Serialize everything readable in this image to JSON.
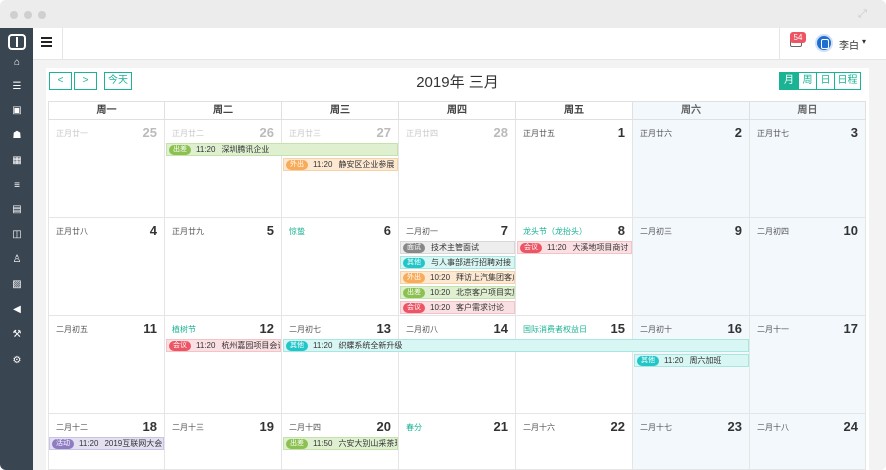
{
  "window": {
    "controls": [
      "close",
      "minimize",
      "zoom"
    ]
  },
  "sidebar": {
    "icons": [
      "logo-icon",
      "home-icon",
      "list-icon",
      "briefcase-icon",
      "users-icon",
      "calendar-icon",
      "table-icon",
      "book-icon",
      "columns-icon",
      "person-icon",
      "image-icon",
      "bullhorn-icon",
      "gavel-icon",
      "cogs-icon"
    ]
  },
  "topbar": {
    "mail_count": "54",
    "user_name": "李白",
    "caret": "▾"
  },
  "calendar": {
    "title": "2019年 三月",
    "prev": "<",
    "next": ">",
    "today": "今天",
    "views": [
      {
        "label": "月",
        "active": true
      },
      {
        "label": "周",
        "active": false
      },
      {
        "label": "日",
        "active": false
      },
      {
        "label": "日程",
        "active": false
      }
    ],
    "weekdays": [
      "周一",
      "周二",
      "周三",
      "周四",
      "周五",
      "周六",
      "周日"
    ],
    "weeks": [
      [
        {
          "d": "25",
          "l": "正月廿一",
          "o": true
        },
        {
          "d": "26",
          "l": "正月廿二",
          "o": true
        },
        {
          "d": "27",
          "l": "正月廿三",
          "o": true
        },
        {
          "d": "28",
          "l": "正月廿四",
          "o": true
        },
        {
          "d": "1",
          "l": "正月廿五"
        },
        {
          "d": "2",
          "l": "正月廿六"
        },
        {
          "d": "3",
          "l": "正月廿七"
        }
      ],
      [
        {
          "d": "4",
          "l": "正月廿八"
        },
        {
          "d": "5",
          "l": "正月廿九"
        },
        {
          "d": "6",
          "l": "惊蛰",
          "f": true
        },
        {
          "d": "7",
          "l": "二月初一"
        },
        {
          "d": "8",
          "l": "龙头节（龙抬头）",
          "f": true
        },
        {
          "d": "9",
          "l": "二月初三"
        },
        {
          "d": "10",
          "l": "二月初四"
        }
      ],
      [
        {
          "d": "11",
          "l": "二月初五"
        },
        {
          "d": "12",
          "l": "植树节",
          "f": true
        },
        {
          "d": "13",
          "l": "二月初七"
        },
        {
          "d": "14",
          "l": "二月初八"
        },
        {
          "d": "15",
          "l": "国际消费者权益日",
          "f": true
        },
        {
          "d": "16",
          "l": "二月初十"
        },
        {
          "d": "17",
          "l": "二月十一"
        }
      ],
      [
        {
          "d": "18",
          "l": "二月十二"
        },
        {
          "d": "19",
          "l": "二月十三"
        },
        {
          "d": "20",
          "l": "二月十四"
        },
        {
          "d": "21",
          "l": "春分",
          "f": true
        },
        {
          "d": "22",
          "l": "二月十六"
        },
        {
          "d": "23",
          "l": "二月十七"
        },
        {
          "d": "24",
          "l": "二月十八"
        }
      ]
    ],
    "events": [
      {
        "week": 0,
        "start": 1,
        "span": 2,
        "slot": 0,
        "tag": "出差",
        "time": "11:20",
        "title": "深圳腾讯企业",
        "type": "trip"
      },
      {
        "week": 0,
        "start": 2,
        "span": 1,
        "slot": 1,
        "tag": "外出",
        "time": "11:20",
        "title": "静安区企业参展",
        "type": "out"
      },
      {
        "week": 1,
        "start": 3,
        "span": 1,
        "slot": 0,
        "tag": "面试",
        "time": "",
        "title": "技术主管面试",
        "type": "interview"
      },
      {
        "week": 1,
        "start": 4,
        "span": 1,
        "slot": 0,
        "tag": "会议",
        "time": "11:20",
        "title": "大溪地项目商讨",
        "type": "meeting"
      },
      {
        "week": 1,
        "start": 3,
        "span": 1,
        "slot": 1,
        "tag": "其他",
        "time": "",
        "title": "与人事部进行招聘对接",
        "type": "other"
      },
      {
        "week": 1,
        "start": 3,
        "span": 1,
        "slot": 2,
        "tag": "外出",
        "time": "10:20",
        "title": "拜访上汽集团客户",
        "type": "out"
      },
      {
        "week": 1,
        "start": 3,
        "span": 1,
        "slot": 3,
        "tag": "出差",
        "time": "10:20",
        "title": "北京客户项目实施",
        "type": "trip"
      },
      {
        "week": 1,
        "start": 3,
        "span": 1,
        "slot": 4,
        "tag": "会议",
        "time": "10:20",
        "title": "客户需求讨论",
        "type": "meeting"
      },
      {
        "week": 2,
        "start": 1,
        "span": 1,
        "slot": 0,
        "tag": "会议",
        "time": "11:20",
        "title": "杭州嘉园项目会议",
        "type": "meeting"
      },
      {
        "week": 2,
        "start": 2,
        "span": 4,
        "slot": 0,
        "tag": "其他",
        "time": "11:20",
        "title": "织蝶系统全新升级",
        "type": "other"
      },
      {
        "week": 2,
        "start": 5,
        "span": 1,
        "slot": 1,
        "tag": "其他",
        "time": "11:20",
        "title": "周六加班",
        "type": "other"
      },
      {
        "week": 3,
        "start": 0,
        "span": 1,
        "slot": 0,
        "tag": "活动",
        "time": "11:20",
        "title": "2019互联网大会",
        "type": "activity"
      },
      {
        "week": 3,
        "start": 2,
        "span": 1,
        "slot": 0,
        "tag": "出差",
        "time": "11:50",
        "title": "六安大别山采茶现场",
        "type": "trip"
      }
    ],
    "styles": {
      "trip": {
        "tag": "#8cc152",
        "bg": "#dff0d0",
        "border": "#c5e2ad"
      },
      "out": {
        "tag": "#f8ac59",
        "bg": "#fde9d2",
        "border": "#f6d2a8"
      },
      "interview": {
        "tag": "#888888",
        "bg": "#ededed",
        "border": "#d8d8d8"
      },
      "meeting": {
        "tag": "#ed5565",
        "bg": "#fbe0e3",
        "border": "#f4c3c8"
      },
      "other": {
        "tag": "#23c6c8",
        "bg": "#d8f6f3",
        "border": "#a8e6e0"
      },
      "activity": {
        "tag": "#8e7cc3",
        "bg": "#e4e0f2",
        "border": "#cbc3e6"
      }
    }
  }
}
